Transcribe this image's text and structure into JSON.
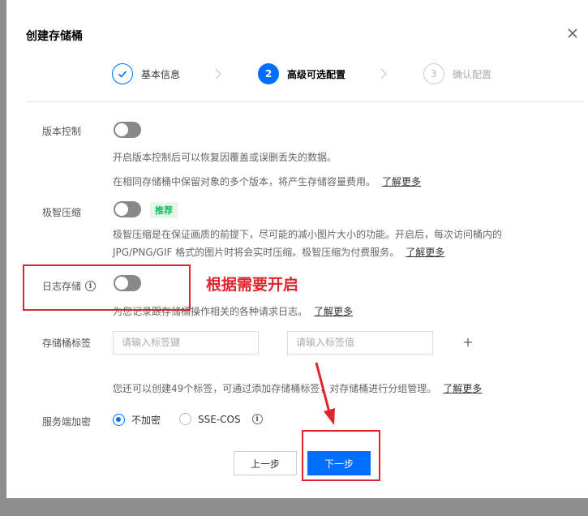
{
  "dialog": {
    "title": "创建存储桶"
  },
  "steps": [
    {
      "num": "",
      "label": "基本信息",
      "state": "done"
    },
    {
      "num": "2",
      "label": "高级可选配置",
      "state": "active"
    },
    {
      "num": "3",
      "label": "确认配置",
      "state": "pending"
    }
  ],
  "versioning": {
    "label": "版本控制",
    "desc1": "开启版本控制后可以恢复因覆盖或误删丢失的数据。",
    "desc2": "在相同存储桶中保留对象的多个版本，将产生存储容量费用。",
    "link": "了解更多"
  },
  "compression": {
    "label": "极智压缩",
    "badge": "推荐",
    "desc1": "极智压缩是在保证画质的前提下，尽可能的减小图片大小的功能。开启后，每次访问桶内的",
    "desc2": "JPG/PNG/GIF 格式的图片时将会实时压缩。极智压缩为付费服务。",
    "link": "了解更多"
  },
  "logging": {
    "label": "日志存储",
    "desc": "为您记录跟存储桶操作相关的各种请求日志。",
    "link": "了解更多"
  },
  "tags": {
    "label": "存储桶标签",
    "key_placeholder": "请输入标签键",
    "value_placeholder": "请输入标签值",
    "plus": "+",
    "desc": "您还可以创建49个标签，可通过添加存储桶标签，对存储桶进行分组管理。",
    "link": "了解更多"
  },
  "encryption": {
    "label": "服务端加密",
    "options": [
      "不加密",
      "SSE-COS"
    ],
    "selected": "不加密"
  },
  "footer": {
    "prev": "上一步",
    "next": "下一步"
  },
  "annotation": {
    "text": "根据需要开启",
    "color": "#e0242e"
  },
  "colors": {
    "primary": "#006eff",
    "success": "#0abf5b"
  }
}
